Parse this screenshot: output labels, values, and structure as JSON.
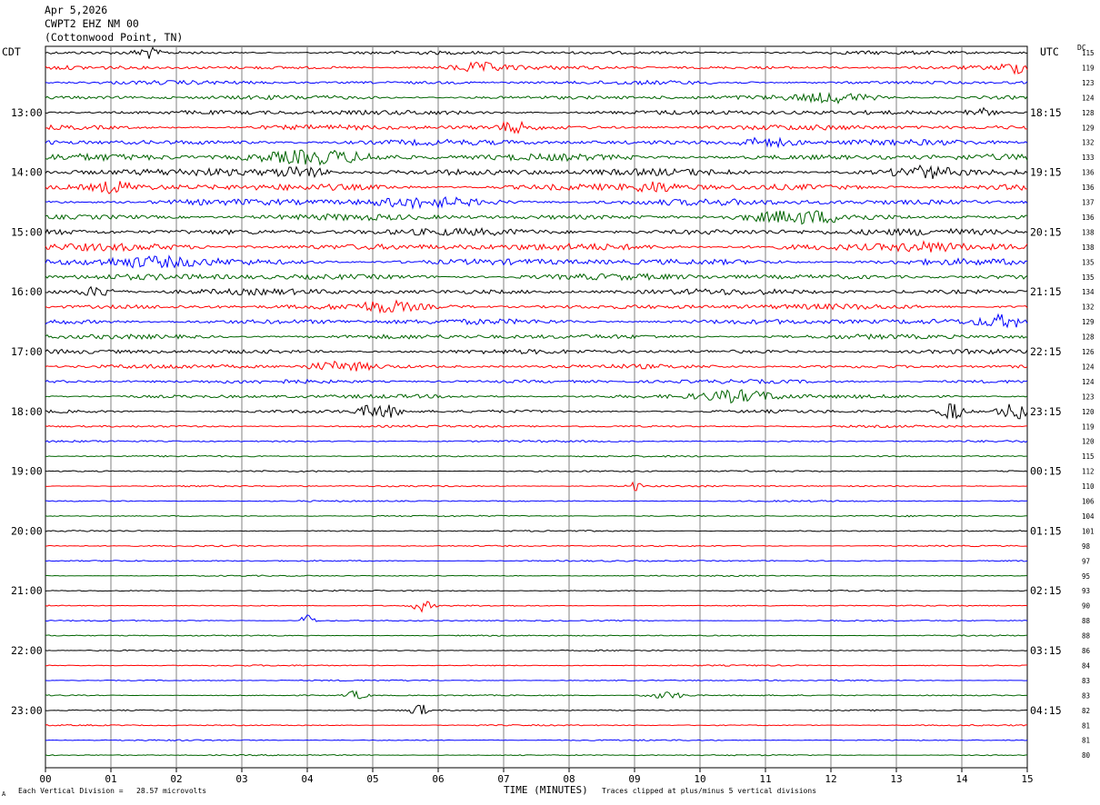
{
  "header": {
    "date": "Apr 5,2026",
    "station": "CWPT2 EHZ NM 00",
    "location": "(Cottonwood Point, TN)"
  },
  "axes": {
    "left_zone": "CDT",
    "right_zone": "UTC",
    "dc_header": "DC",
    "x_label": "TIME (MINUTES)"
  },
  "footer": {
    "scale_note": "Each Vertical Division =   28.57 microvolts",
    "clip_note": "Traces clipped at plus/minus 5 vertical divisions",
    "corner_mark": "A"
  },
  "colors": {
    "cycle": [
      "#000000",
      "#ff0000",
      "#0000ff",
      "#006400"
    ],
    "grid": "#808080"
  },
  "chart_data": {
    "type": "helicorder",
    "xlim": [
      0,
      15
    ],
    "x_ticks": [
      "00",
      "01",
      "02",
      "03",
      "04",
      "05",
      "06",
      "07",
      "08",
      "09",
      "10",
      "11",
      "12",
      "13",
      "14",
      "15"
    ],
    "left_hour_labels": [
      {
        "row": 4,
        "label": "13:00"
      },
      {
        "row": 8,
        "label": "14:00"
      },
      {
        "row": 12,
        "label": "15:00"
      },
      {
        "row": 16,
        "label": "16:00"
      },
      {
        "row": 20,
        "label": "17:00"
      },
      {
        "row": 24,
        "label": "18:00"
      },
      {
        "row": 28,
        "label": "19:00"
      },
      {
        "row": 32,
        "label": "20:00"
      },
      {
        "row": 36,
        "label": "21:00"
      },
      {
        "row": 40,
        "label": "22:00"
      },
      {
        "row": 44,
        "label": "23:00"
      }
    ],
    "right_hour_labels": [
      {
        "row": 4,
        "label": "18:15"
      },
      {
        "row": 8,
        "label": "19:15"
      },
      {
        "row": 12,
        "label": "20:15"
      },
      {
        "row": 16,
        "label": "21:15"
      },
      {
        "row": 20,
        "label": "22:15"
      },
      {
        "row": 24,
        "label": "23:15"
      },
      {
        "row": 28,
        "label": "00:15"
      },
      {
        "row": 32,
        "label": "01:15"
      },
      {
        "row": 36,
        "label": "02:15"
      },
      {
        "row": 40,
        "label": "03:15"
      },
      {
        "row": 44,
        "label": "04:15"
      }
    ],
    "dc_values": [
      115,
      119,
      123,
      124,
      128,
      129,
      132,
      133,
      136,
      136,
      137,
      136,
      138,
      138,
      135,
      135,
      134,
      132,
      129,
      128,
      126,
      124,
      124,
      123,
      120,
      119,
      120,
      115,
      112,
      110,
      106,
      104,
      101,
      98,
      97,
      95,
      93,
      90,
      88,
      88,
      86,
      84,
      83,
      83,
      82,
      81,
      81,
      80
    ],
    "amplitude": [
      2.2,
      2.4,
      2.4,
      2.6,
      3.0,
      3.2,
      3.4,
      4.0,
      4.4,
      4.2,
      4.0,
      3.8,
      4.2,
      4.4,
      4.0,
      3.8,
      3.6,
      3.4,
      3.4,
      3.0,
      2.8,
      2.6,
      2.4,
      2.4,
      2.0,
      1.4,
      1.2,
      1.0,
      1.0,
      1.0,
      0.9,
      0.9,
      0.9,
      0.9,
      0.9,
      0.8,
      0.8,
      0.8,
      0.8,
      0.8,
      0.8,
      0.8,
      0.8,
      0.8,
      0.8,
      0.8,
      0.8,
      0.8
    ],
    "bursts": [
      {
        "row": 0,
        "min": 1.4,
        "dur": 0.3,
        "amp": 3
      },
      {
        "row": 1,
        "min": 6.2,
        "dur": 0.8,
        "amp": 2.2
      },
      {
        "row": 1,
        "min": 14.6,
        "dur": 0.4,
        "amp": 2.5
      },
      {
        "row": 3,
        "min": 11.5,
        "dur": 1.2,
        "amp": 2.5
      },
      {
        "row": 4,
        "min": 14.0,
        "dur": 0.5,
        "amp": 2.5
      },
      {
        "row": 5,
        "min": 6.9,
        "dur": 0.5,
        "amp": 2.5
      },
      {
        "row": 6,
        "min": 10.5,
        "dur": 1.0,
        "amp": 2.2
      },
      {
        "row": 7,
        "min": 3.2,
        "dur": 1.8,
        "amp": 3.2
      },
      {
        "row": 8,
        "min": 3.5,
        "dur": 0.8,
        "amp": 2.8
      },
      {
        "row": 8,
        "min": 13.0,
        "dur": 0.8,
        "amp": 2.4
      },
      {
        "row": 9,
        "min": 0.8,
        "dur": 0.5,
        "amp": 2.5
      },
      {
        "row": 9,
        "min": 9.0,
        "dur": 0.6,
        "amp": 2.2
      },
      {
        "row": 10,
        "min": 5.0,
        "dur": 1.5,
        "amp": 2.0
      },
      {
        "row": 11,
        "min": 10.8,
        "dur": 1.4,
        "amp": 2.4
      },
      {
        "row": 13,
        "min": 13.0,
        "dur": 1.0,
        "amp": 2.0
      },
      {
        "row": 14,
        "min": 0.8,
        "dur": 1.5,
        "amp": 2.2
      },
      {
        "row": 16,
        "min": 0.5,
        "dur": 0.6,
        "amp": 2.5
      },
      {
        "row": 17,
        "min": 4.8,
        "dur": 0.8,
        "amp": 2.2
      },
      {
        "row": 18,
        "min": 14.3,
        "dur": 0.7,
        "amp": 3.0
      },
      {
        "row": 21,
        "min": 4.0,
        "dur": 1.0,
        "amp": 2.4
      },
      {
        "row": 23,
        "min": 10.0,
        "dur": 1.2,
        "amp": 3.0
      },
      {
        "row": 24,
        "min": 4.8,
        "dur": 0.6,
        "amp": 4.0
      },
      {
        "row": 24,
        "min": 13.7,
        "dur": 0.3,
        "amp": 6.0
      },
      {
        "row": 24,
        "min": 14.6,
        "dur": 0.4,
        "amp": 6.0
      },
      {
        "row": 29,
        "min": 8.9,
        "dur": 0.2,
        "amp": 2.5
      },
      {
        "row": 37,
        "min": 5.6,
        "dur": 0.3,
        "amp": 3.0
      },
      {
        "row": 38,
        "min": 3.9,
        "dur": 0.2,
        "amp": 4.0
      },
      {
        "row": 43,
        "min": 4.6,
        "dur": 0.3,
        "amp": 2.5
      },
      {
        "row": 43,
        "min": 9.2,
        "dur": 0.6,
        "amp": 2.0
      },
      {
        "row": 44,
        "min": 5.6,
        "dur": 0.2,
        "amp": 5.0
      }
    ]
  }
}
